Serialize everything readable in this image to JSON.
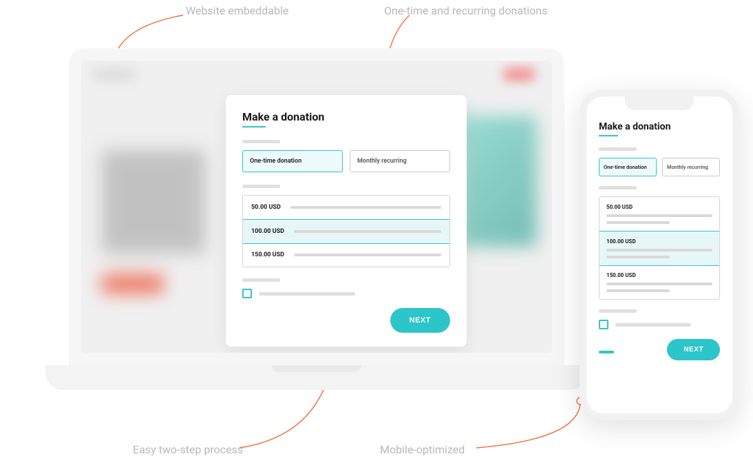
{
  "callouts": {
    "embeddable": "Website embeddable",
    "recurring": "One-time and recurring donations",
    "two_step": "Easy two-step process",
    "mobile": "Mobile-optimized"
  },
  "form": {
    "title": "Make a donation",
    "tabs": {
      "onetime": "One-time donation",
      "monthly": "Monthly recurring"
    },
    "amounts": [
      {
        "label": "50.00 USD"
      },
      {
        "label": "100.00 USD"
      },
      {
        "label": "150.00 USD"
      }
    ],
    "next_label": "NEXT"
  },
  "colors": {
    "accent": "#2cc5c9",
    "callout_line": "#f26b3a"
  }
}
